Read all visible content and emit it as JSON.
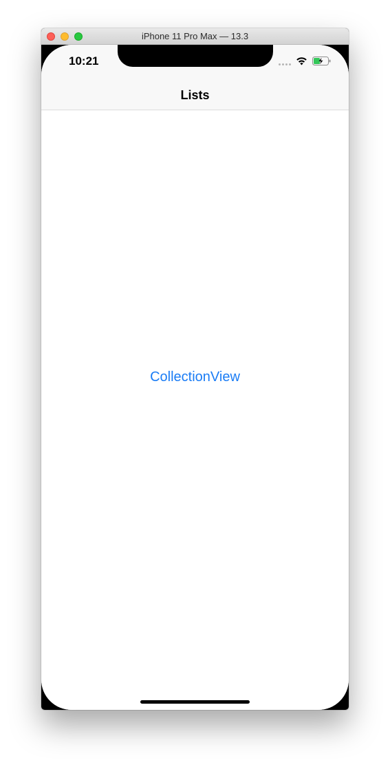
{
  "window": {
    "title": "iPhone 11 Pro Max — 13.3"
  },
  "status_bar": {
    "time": "10:21",
    "icons": [
      "signal-icon",
      "wifi-icon",
      "battery-charging-icon"
    ]
  },
  "nav_bar": {
    "title": "Lists"
  },
  "content": {
    "link_label": "CollectionView"
  },
  "colors": {
    "accent": "#1a7cf5",
    "nav_background": "#f8f8f8",
    "battery_fill": "#34c759"
  }
}
